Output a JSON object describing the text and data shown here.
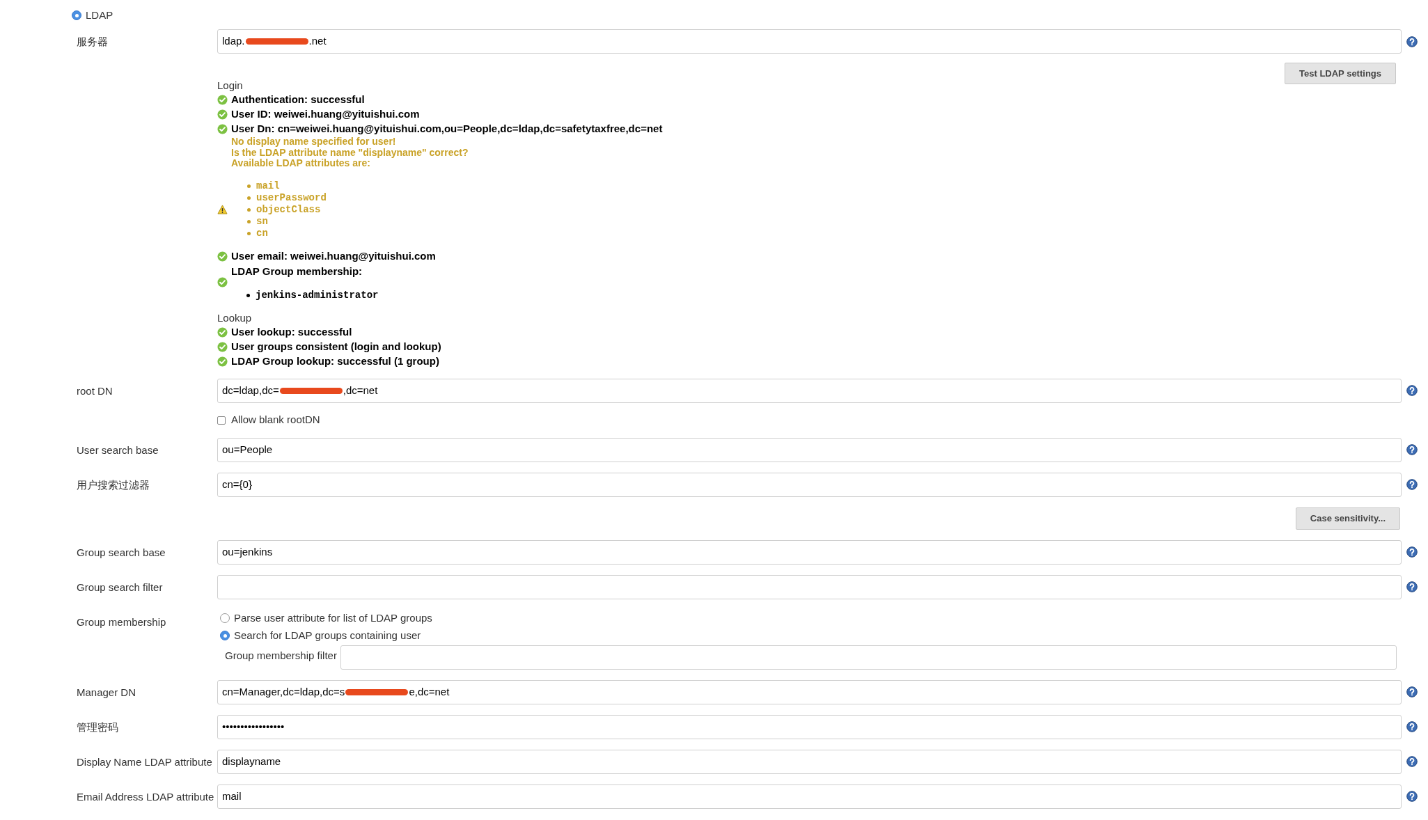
{
  "realm": {
    "label": "LDAP",
    "selected": true
  },
  "server": {
    "label": "服务器",
    "value_start": "ldap.",
    "value_end": ".net"
  },
  "test_button": "Test LDAP settings",
  "login": {
    "title": "Login",
    "results": [
      {
        "kind": "ok",
        "text": "Authentication: successful"
      },
      {
        "kind": "ok",
        "text": "User ID: weiwei.huang@yituishui.com"
      },
      {
        "kind": "ok",
        "text": "User Dn: cn=weiwei.huang@yituishui.com,ou=People,dc=ldap,dc=safetytaxfree,dc=net"
      },
      {
        "kind": "warning",
        "lines": [
          "No display name specified for user!",
          "Is the LDAP attribute name \"displayname\" correct?",
          "Available LDAP attributes are:"
        ],
        "items": [
          "mail",
          "userPassword",
          "objectClass",
          "sn",
          "cn"
        ]
      },
      {
        "kind": "ok",
        "text": "User email: weiwei.huang@yituishui.com"
      },
      {
        "kind": "ok_list",
        "text": "LDAP Group membership:",
        "items": [
          "jenkins-administrator"
        ]
      }
    ]
  },
  "lookup": {
    "title": "Lookup",
    "results": [
      {
        "kind": "ok",
        "text": "User lookup: successful"
      },
      {
        "kind": "ok",
        "text": "User groups consistent (login and lookup)"
      },
      {
        "kind": "ok",
        "text": "LDAP Group lookup: successful (1 group)"
      }
    ]
  },
  "rows": [
    {
      "kind": "field",
      "label": "root DN",
      "value_start": "dc=ldap,dc=",
      "value_end": ",dc=net",
      "help": true
    },
    {
      "kind": "checkbox",
      "text": "Allow blank rootDN",
      "checked": false
    },
    {
      "kind": "field",
      "label": "User search base",
      "value": "ou=People",
      "help": true
    },
    {
      "kind": "field",
      "label": "用户搜索过滤器",
      "value": "cn={0}",
      "help": true
    },
    {
      "kind": "button",
      "text": "Case sensitivity..."
    },
    {
      "kind": "field",
      "label": "Group search base",
      "value": "ou=jenkins",
      "help": true
    },
    {
      "kind": "field",
      "label": "Group search filter",
      "help": true
    },
    {
      "kind": "radios",
      "label": "Group membership",
      "options": [
        {
          "text": "Parse user attribute for list of LDAP groups",
          "selected": false
        },
        {
          "text": "Search for LDAP groups containing user",
          "selected": true
        }
      ],
      "subfield": {
        "label": "Group membership filter"
      }
    },
    {
      "kind": "field",
      "label": "Manager DN",
      "value_start": "cn=Manager,dc=ldap,dc=s",
      "value_end": "e,dc=net",
      "help": true
    },
    {
      "kind": "field",
      "label": "管理密码",
      "value": "•••••••••••••••••",
      "help": true
    },
    {
      "kind": "field",
      "label": "Display Name LDAP attribute",
      "value": "displayname",
      "help": true
    },
    {
      "kind": "field",
      "label": "Email Address LDAP attribute",
      "value": "mail",
      "help": true
    }
  ]
}
